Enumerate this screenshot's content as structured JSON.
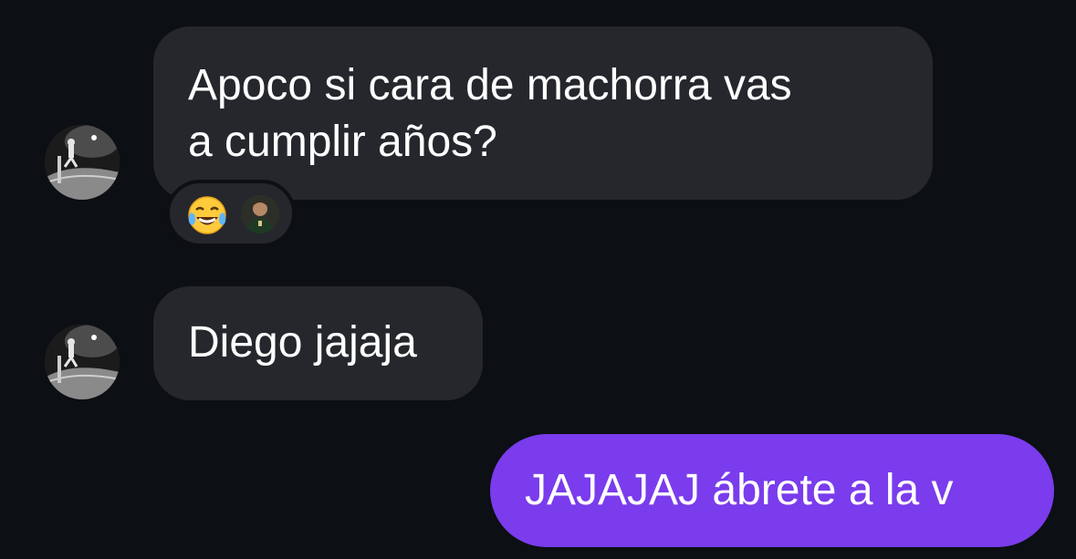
{
  "messages": [
    {
      "direction": "incoming",
      "sender_avatar": "skatepark-photo-avatar",
      "lines": [
        "Apoco si cara de machorra vas",
        "a cumplir años?"
      ],
      "reactions": [
        {
          "icon": "face-with-tears-of-joy-emoji"
        },
        {
          "icon": "reactor-avatar"
        }
      ]
    },
    {
      "direction": "incoming",
      "sender_avatar": "skatepark-photo-avatar",
      "text": "Diego jajaja"
    },
    {
      "direction": "outgoing",
      "text": "JAJAJAJ ábrete a la v"
    }
  ],
  "colors": {
    "background": "#0c0f14",
    "incoming_bubble": "#25272c",
    "outgoing_bubble": "#7a3cec",
    "text": "#ffffff"
  }
}
